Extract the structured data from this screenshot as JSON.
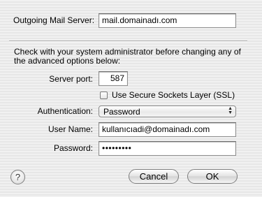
{
  "outgoing": {
    "label": "Outgoing Mail Server:",
    "value": "mail.domainadı.com"
  },
  "notice": {
    "line1": "Check with your system administrator before changing any of",
    "line2": "the advanced options below:"
  },
  "server_port": {
    "label": "Server port:",
    "value": "587"
  },
  "ssl": {
    "label": "Use Secure Sockets Layer (SSL)",
    "checked": false
  },
  "authentication": {
    "label": "Authentication:",
    "value": "Password"
  },
  "user_name": {
    "label": "User Name:",
    "value": "kullanıcıadi@domainadı.com"
  },
  "password": {
    "label": "Password:",
    "value": "•••••••••"
  },
  "buttons": {
    "help": "?",
    "cancel": "Cancel",
    "ok": "OK"
  }
}
